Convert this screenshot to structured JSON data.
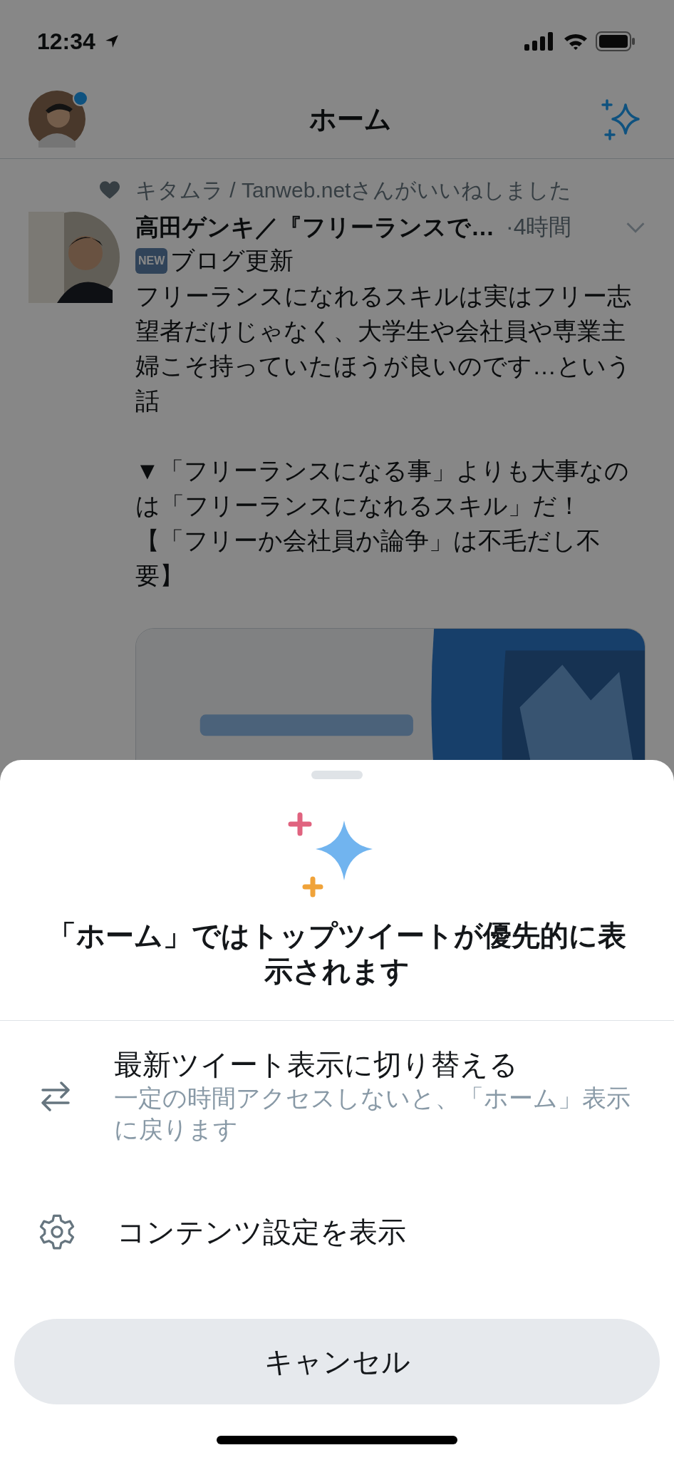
{
  "status_bar": {
    "time": "12:34"
  },
  "header": {
    "title": "ホーム",
    "avatar_badge": true
  },
  "tweet": {
    "social_context": "キタムラ / Tanweb.netさんがいいねしました",
    "author": "高田ゲンキ／『フリーランスで…",
    "time": "·4時間",
    "badge": "NEW",
    "headline": "ブログ更新",
    "paragraphs": [
      [
        "フリーランスになれるスキルは実はフリー志望者だけじゃなく、大学生や会社員や専業主婦こそ持っていたほうが良いのです…という話"
      ],
      [
        "▼「フリーランスになる事」よりも大事なのは「フリーランスになれるスキル」だ！",
        "【「フリーか会社員か論争」は不毛だし不要】"
      ]
    ],
    "media": {
      "kind": "picture"
    }
  },
  "sheet": {
    "title": "「ホーム」ではトップツイートが優先的に表示されます",
    "options": [
      {
        "kind": "switch",
        "label": "最新ツイート表示に切り替える",
        "description": "一定の時間アクセスしないと、「ホーム」表示に戻ります"
      },
      {
        "kind": "settings",
        "label": "コンテンツ設定を表示"
      }
    ],
    "cancel": "キャンセル"
  }
}
